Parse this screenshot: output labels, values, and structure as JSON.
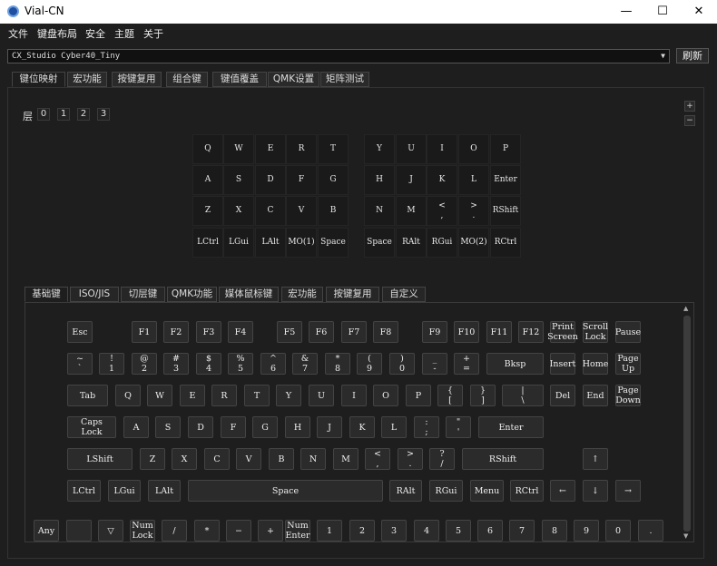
{
  "window": {
    "title": "Vial-CN",
    "minimize": "—",
    "maximize": "☐",
    "close": "✕"
  },
  "menu": [
    "文件",
    "键盘布局",
    "安全",
    "主题",
    "关于"
  ],
  "keyboard_select": {
    "value": "CX_Studio Cyber40_Tiny",
    "refresh_label": "刷新"
  },
  "top_tabs": [
    "键位映射",
    "宏功能",
    "按键复用",
    "组合键",
    "键值覆盖",
    "QMK设置",
    "矩阵测试"
  ],
  "layers": {
    "label": "层",
    "items": [
      "0",
      "1",
      "2",
      "3"
    ],
    "plus": "+",
    "minus": "−"
  },
  "layout": {
    "left": [
      [
        "Q",
        "W",
        "E",
        "R",
        "T"
      ],
      [
        "A",
        "S",
        "D",
        "F",
        "G"
      ],
      [
        "Z",
        "X",
        "C",
        "V",
        "B"
      ],
      [
        "LCtrl",
        "LGui",
        "LAlt",
        "MO(1)",
        "Space"
      ]
    ],
    "right": [
      [
        "Y",
        "U",
        "I",
        "O",
        "P"
      ],
      [
        "H",
        "J",
        "K",
        "L",
        "Enter"
      ],
      [
        "N",
        "M",
        "<\n,",
        ">\n.",
        "RShift"
      ],
      [
        "Space",
        "RAlt",
        "RGui",
        "MO(2)",
        "RCtrl"
      ]
    ]
  },
  "bottom_tabs": [
    "基础键",
    "ISO/JIS",
    "切层键",
    "QMK功能",
    "媒体鼠标键",
    "宏功能",
    "按键复用",
    "自定义"
  ],
  "palette": {
    "row0": [
      "Esc",
      "F1",
      "F2",
      "F3",
      "F4",
      "F5",
      "F6",
      "F7",
      "F8",
      "F9",
      "F10",
      "F11",
      "F12",
      "Print\nScreen",
      "Scroll\nLock",
      "Pause"
    ],
    "row1": [
      "~\n`",
      "!\n1",
      "@\n2",
      "#\n3",
      "$\n4",
      "%\n5",
      "^\n6",
      "&\n7",
      "*\n8",
      "(\n9",
      ")\n0",
      "_\n-",
      "+\n=",
      "Bksp",
      "Insert",
      "Home",
      "Page\nUp"
    ],
    "row2": [
      "Tab",
      "Q",
      "W",
      "E",
      "R",
      "T",
      "Y",
      "U",
      "I",
      "O",
      "P",
      "{\n[",
      "}\n]",
      "|\n\\",
      "Del",
      "End",
      "Page\nDown"
    ],
    "row3": [
      "Caps\nLock",
      "A",
      "S",
      "D",
      "F",
      "G",
      "H",
      "J",
      "K",
      "L",
      ":\n;",
      "\"\n'",
      "Enter"
    ],
    "row4": [
      "LShift",
      "Z",
      "X",
      "C",
      "V",
      "B",
      "N",
      "M",
      "<\n,",
      ">\n.",
      "?\n/",
      "RShift",
      "↑"
    ],
    "row5": [
      "LCtrl",
      "LGui",
      "LAlt",
      "Space",
      "RAlt",
      "RGui",
      "Menu",
      "RCtrl",
      "←",
      "↓",
      "→"
    ],
    "row6": [
      "Any",
      "",
      "▽",
      "Num\nLock",
      "/",
      "*",
      "−",
      "+",
      "Num\nEnter",
      "1",
      "2",
      "3",
      "4",
      "5",
      "6",
      "7",
      "8",
      "9",
      "0",
      "."
    ]
  }
}
